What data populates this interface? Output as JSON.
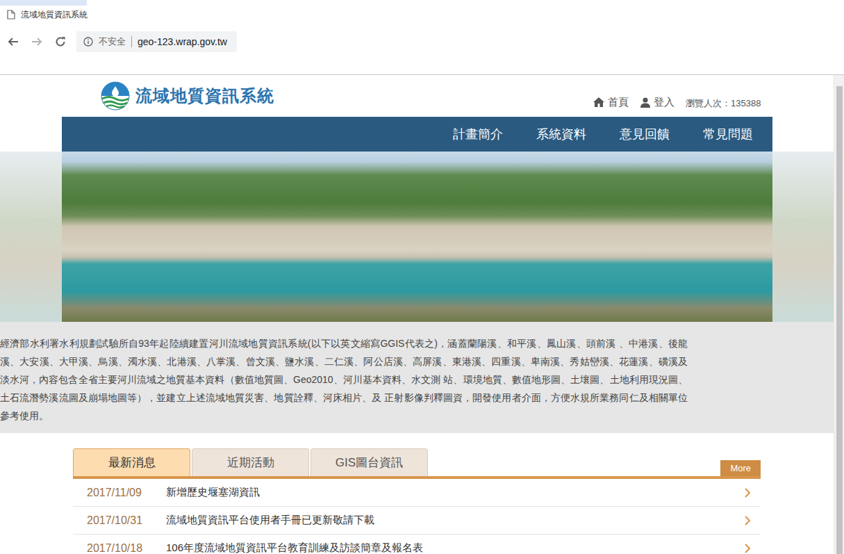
{
  "browser": {
    "tab_title": "流域地質資訊系統",
    "security": "不安全",
    "url": "geo-123.wrap.gov.tw"
  },
  "site": {
    "title": "流域地質資訊系統",
    "home": "首頁",
    "login": "登入",
    "visits": "瀏覽人次：135388"
  },
  "menu": [
    "計畫簡介",
    "系統資料",
    "意見回饋",
    "常見問題"
  ],
  "intro": "經濟部水利署水利規劃試驗所自93年起陸續建置河川流域地質資訊系統(以下以英文縮寫GGIS代表之)，涵蓋蘭陽溪、和平溪、鳳山溪、頭前溪 、中港溪、後龍溪、大安溪、大甲溪、烏溪、濁水溪、北港溪、八掌溪、曾文溪、鹽水溪、二仁溪、阿公店溪、高屏溪、東港溪、四重溪、卑南溪、秀姑巒溪、花蓮溪、磺溪及淡水河，內容包含全省主要河川流域之地質基本資料（數值地質圖、Geo2010、河川基本資料、水文測 站、環境地質、數值地形圖、土壤圖、土地利用現況圖、土石流潛勢溪流圖及崩塌地圖等），並建立上述流域地質災害、地質詮釋、河床相片、及 正射影像判釋圖資，開發使用者介面，方便水規所業務同仁及相關單位參考使用。",
  "tabs": [
    {
      "label": "最新消息",
      "selected": true
    },
    {
      "label": "近期活動",
      "selected": false
    },
    {
      "label": "GIS圖台資訊",
      "selected": false
    }
  ],
  "more": "More",
  "news": [
    {
      "date": "2017/11/09",
      "title": "新增歷史堰塞湖資訊"
    },
    {
      "date": "2017/10/31",
      "title": "流域地質資訊平台使用者手冊已更新敬請下載"
    },
    {
      "date": "2017/10/18",
      "title": "106年度流域地質資訊平台教育訓練及訪談簡章及報名表"
    }
  ]
}
